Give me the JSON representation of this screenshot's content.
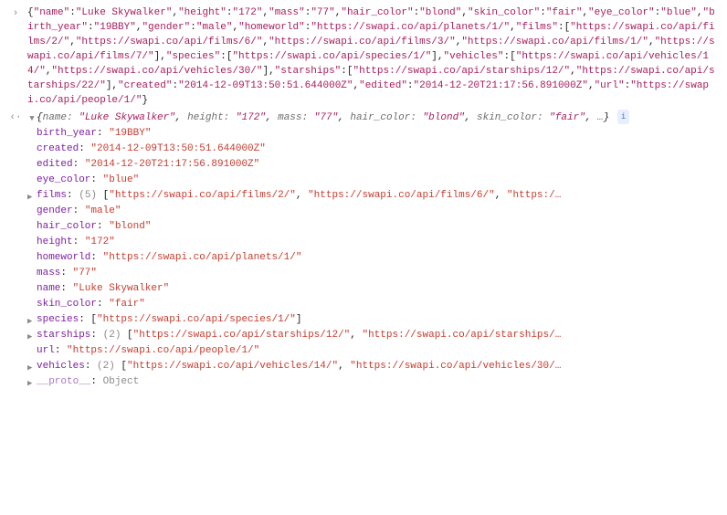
{
  "raw_json_text": "{\"name\":\"Luke Skywalker\",\"height\":\"172\",\"mass\":\"77\",\"hair_color\":\"blond\",\"skin_color\":\"fair\",\"eye_color\":\"blue\",\"birth_year\":\"19BBY\",\"gender\":\"male\",\"homeworld\":\"https://swapi.co/api/planets/1/\",\"films\":[\"https://swapi.co/api/films/2/\",\"https://swapi.co/api/films/6/\",\"https://swapi.co/api/films/3/\",\"https://swapi.co/api/films/1/\",\"https://swapi.co/api/films/7/\"],\"species\":[\"https://swapi.co/api/species/1/\"],\"vehicles\":[\"https://swapi.co/api/vehicles/14/\",\"https://swapi.co/api/vehicles/30/\"],\"starships\":[\"https://swapi.co/api/starships/12/\",\"https://swapi.co/api/starships/22/\"],\"created\":\"2014-12-09T13:50:51.644000Z\",\"edited\":\"2014-12-20T21:17:56.891000Z\",\"url\":\"https://swapi.co/api/people/1/\"}",
  "summary_line_html": "{<span class='summary-key'>name:</span> <span class='summary-val'>\"Luke Skywalker\"</span>, <span class='summary-key'>height:</span> <span class='summary-val'>\"172\"</span>, <span class='summary-key'>mass:</span> <span class='summary-val'>\"77\"</span>, <span class='summary-key'>hair_color:</span> <span class='summary-val'>\"blond\"</span>, <span class='summary-key'>skin_color:</span> <span class='summary-val'>\"fair\"</span>, <span class='summary-key'>…</span>} <span class='badge' data-name='info-badge' data-interactable='false'>i</span>",
  "props": [
    {
      "key": "birth_year",
      "display": "<span class='pv-str'>\"19BBY\"</span>",
      "expandable": false
    },
    {
      "key": "created",
      "display": "<span class='pv-str'>\"2014-12-09T13:50:51.644000Z\"</span>",
      "expandable": false
    },
    {
      "key": "edited",
      "display": "<span class='pv-str'>\"2014-12-20T21:17:56.891000Z\"</span>",
      "expandable": false
    },
    {
      "key": "eye_color",
      "display": "<span class='pv-str'>\"blue\"</span>",
      "expandable": false
    },
    {
      "key": "films",
      "display": "<span class='pv-dim'>(5)</span> [<span class='pv-str'>\"https://swapi.co/api/films/2/\"</span>, <span class='pv-str'>\"https://swapi.co/api/films/6/\"</span>, <span class='pv-str'>\"https:/…</span>",
      "expandable": true
    },
    {
      "key": "gender",
      "display": "<span class='pv-str'>\"male\"</span>",
      "expandable": false
    },
    {
      "key": "hair_color",
      "display": "<span class='pv-str'>\"blond\"</span>",
      "expandable": false
    },
    {
      "key": "height",
      "display": "<span class='pv-str'>\"172\"</span>",
      "expandable": false
    },
    {
      "key": "homeworld",
      "display": "<span class='pv-str'>\"https://swapi.co/api/planets/1/\"</span>",
      "expandable": false
    },
    {
      "key": "mass",
      "display": "<span class='pv-str'>\"77\"</span>",
      "expandable": false
    },
    {
      "key": "name",
      "display": "<span class='pv-str'>\"Luke Skywalker\"</span>",
      "expandable": false
    },
    {
      "key": "skin_color",
      "display": "<span class='pv-str'>\"fair\"</span>",
      "expandable": false
    },
    {
      "key": "species",
      "display": "[<span class='pv-str'>\"https://swapi.co/api/species/1/\"</span>]",
      "expandable": true
    },
    {
      "key": "starships",
      "display": "<span class='pv-dim'>(2)</span> [<span class='pv-str'>\"https://swapi.co/api/starships/12/\"</span>, <span class='pv-str'>\"https://swapi.co/api/starships/…</span>",
      "expandable": true
    },
    {
      "key": "url",
      "display": "<span class='pv-str'>\"https://swapi.co/api/people/1/\"</span>",
      "expandable": false
    },
    {
      "key": "vehicles",
      "display": "<span class='pv-dim'>(2)</span> [<span class='pv-str'>\"https://swapi.co/api/vehicles/14/\"</span>, <span class='pv-str'>\"https://swapi.co/api/vehicles/30/…</span>",
      "expandable": true
    }
  ],
  "proto_label": "__proto__",
  "proto_value": "Object",
  "gutter_input": "›",
  "gutter_output": "‹·",
  "triangle_down": "▼",
  "triangle_right": "▶"
}
